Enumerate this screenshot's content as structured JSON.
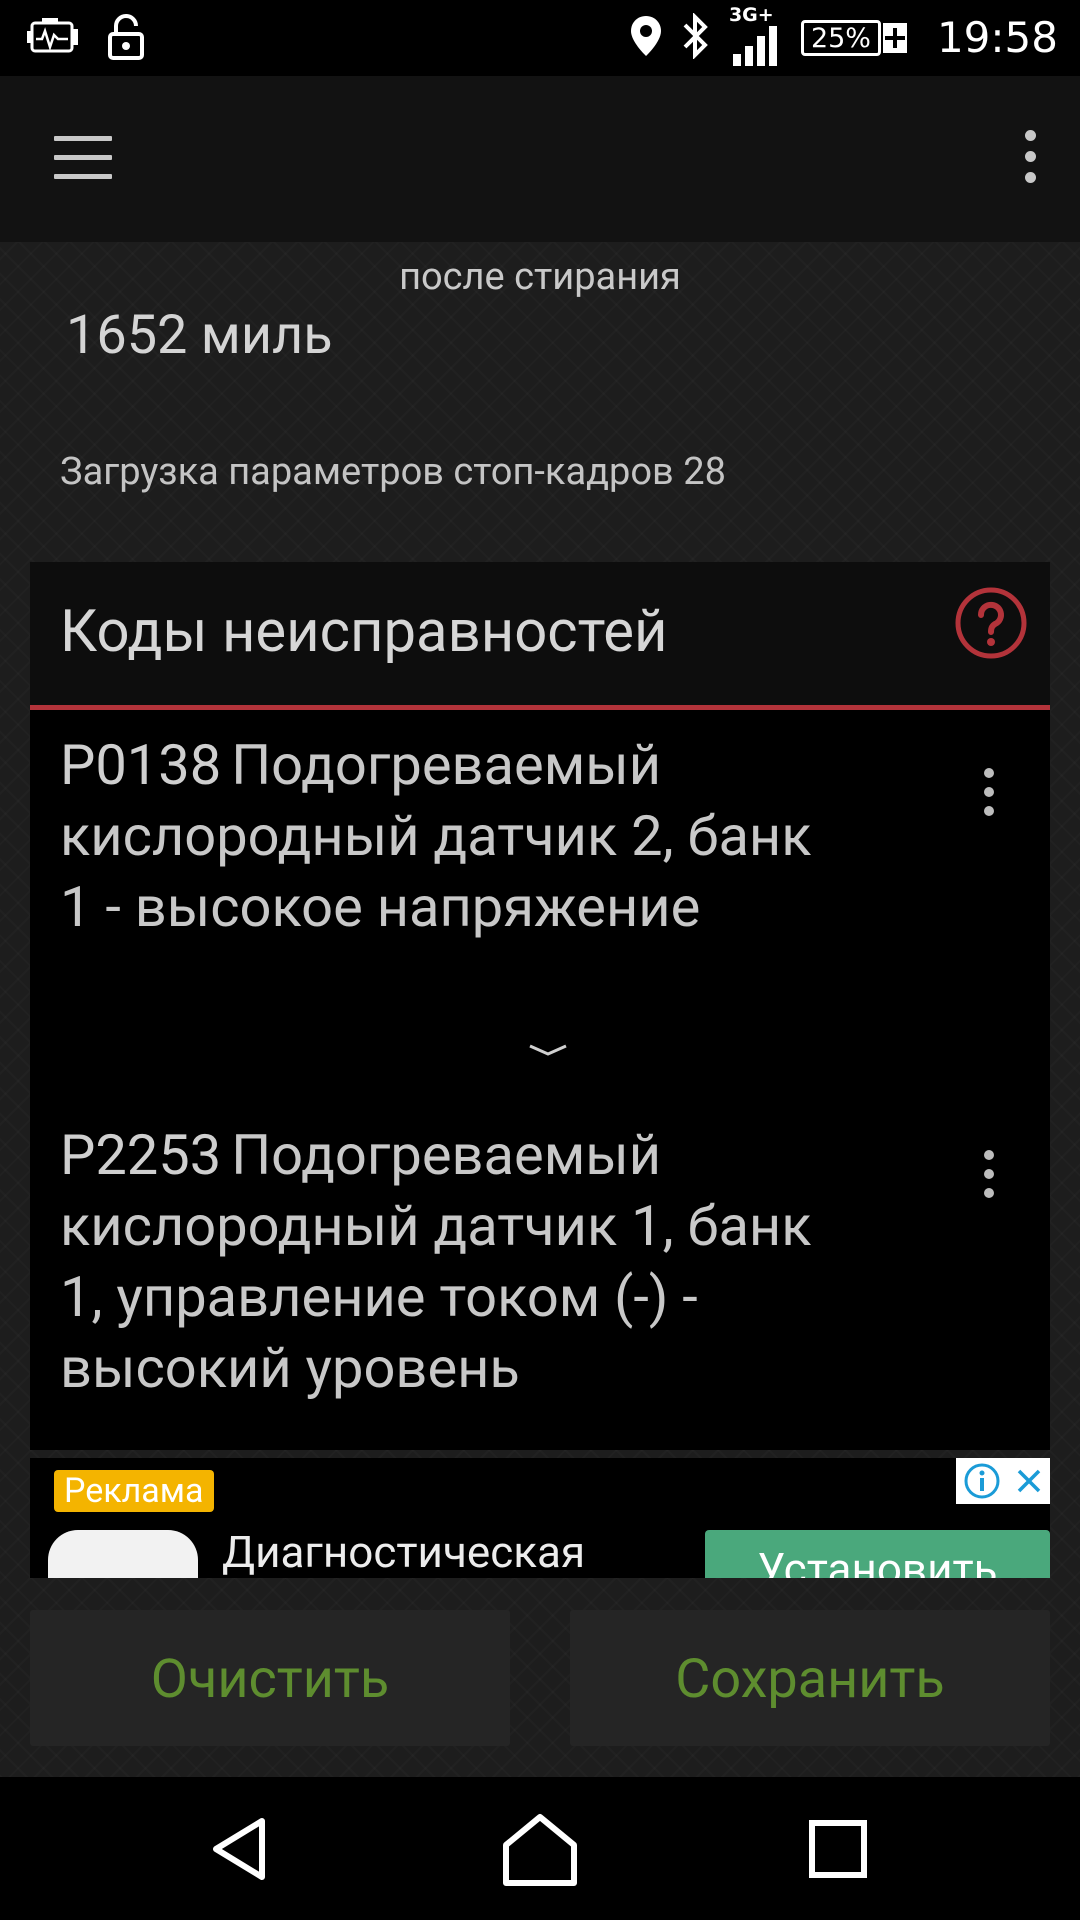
{
  "status_bar": {
    "time": "19:58",
    "battery_percent": "25%",
    "network_type": "3G+",
    "left_icons": [
      "engine-check-icon",
      "lock-open-icon"
    ],
    "right_icons": [
      "location-icon",
      "bluetooth-icon",
      "signal-icon",
      "battery-charging-icon"
    ]
  },
  "app_bar": {
    "menu_icon": "hamburger-menu-icon",
    "overflow_icon": "overflow-menu-icon"
  },
  "summary": {
    "after_clear_label": "после стирания",
    "miles_value": "1652 миль",
    "freeze_frames_label": "Загрузка параметров стоп-кадров 28"
  },
  "dtc_section": {
    "title": "Коды неисправностей",
    "accent_color": "#b3333a",
    "codes": [
      {
        "code": "P0138",
        "description": "Подогреваемый кислородный датчик 2, банк 1 - высокое напряжение"
      },
      {
        "code": "P2253",
        "description": "Подогреваемый кислородный датчик 1, банк 1, управление током (-) - высокий уровень"
      }
    ]
  },
  "ad": {
    "badge": "Реклама",
    "badge_color": "#f4b400",
    "title": "Диагностическая",
    "install_label": "Установить",
    "install_color": "#4aa87c"
  },
  "actions": {
    "clear_label": "Очистить",
    "save_label": "Сохранить",
    "label_color": "#5e8d2f"
  },
  "nav_bar": {
    "back_icon": "back-triangle-icon",
    "home_icon": "home-icon",
    "recents_icon": "recents-square-icon"
  }
}
